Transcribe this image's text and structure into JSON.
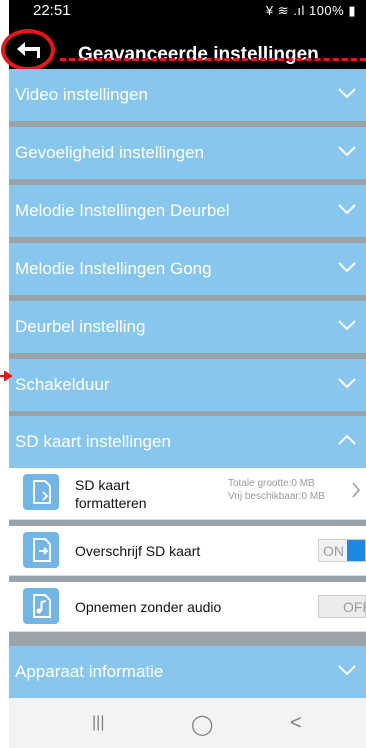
{
  "status_bar": {
    "time": "22:51",
    "icons": "¥ ≋ .ıl 100% ▮"
  },
  "header": {
    "title": "Geavanceerde instellingen"
  },
  "sections": [
    {
      "label": "Video instellingen",
      "expanded": false
    },
    {
      "label": "Gevoeligheid instellingen",
      "expanded": false
    },
    {
      "label": "Melodie Instellingen Deurbel",
      "expanded": false
    },
    {
      "label": "Melodie Instellingen Gong",
      "expanded": false
    },
    {
      "label": "Deurbel instelling",
      "expanded": false
    },
    {
      "label": "Schakelduur",
      "expanded": false
    },
    {
      "label": "SD kaart instellingen",
      "expanded": true
    },
    {
      "label": "Apparaat informatie",
      "expanded": false
    }
  ],
  "sd_rows": {
    "format": {
      "label_line1": "SD kaart",
      "label_line2": "formatteren",
      "total": "Totale grootte:0 MB",
      "free": "Vrij beschikbaar:0 MB"
    },
    "overwrite": {
      "label": "Overschrijf SD kaart",
      "state": "ON"
    },
    "no_audio": {
      "label": "Opnemen zonder audio",
      "state": "OFF"
    }
  },
  "colors": {
    "section_bg": "#87c7ee",
    "accent_red": "#e8151d",
    "toggle_on": "#1e88e5"
  },
  "navbar": {
    "recent": "|||",
    "home": "◯",
    "back": "<"
  }
}
